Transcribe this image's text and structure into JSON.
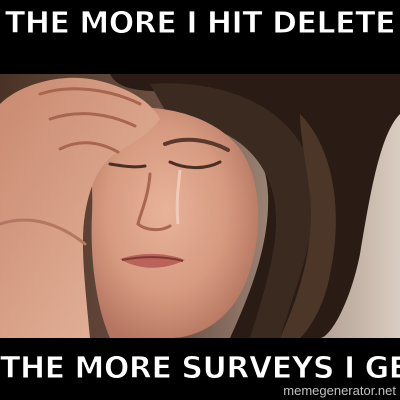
{
  "meme": {
    "top_text": "THE MORE I HIT DELETE",
    "bottom_text": "THE MORE SURVEYS I GET",
    "watermark": "memegenerator.net"
  },
  "colors": {
    "background": "#000000",
    "text": "#ffffff",
    "text_outline": "#000000"
  }
}
